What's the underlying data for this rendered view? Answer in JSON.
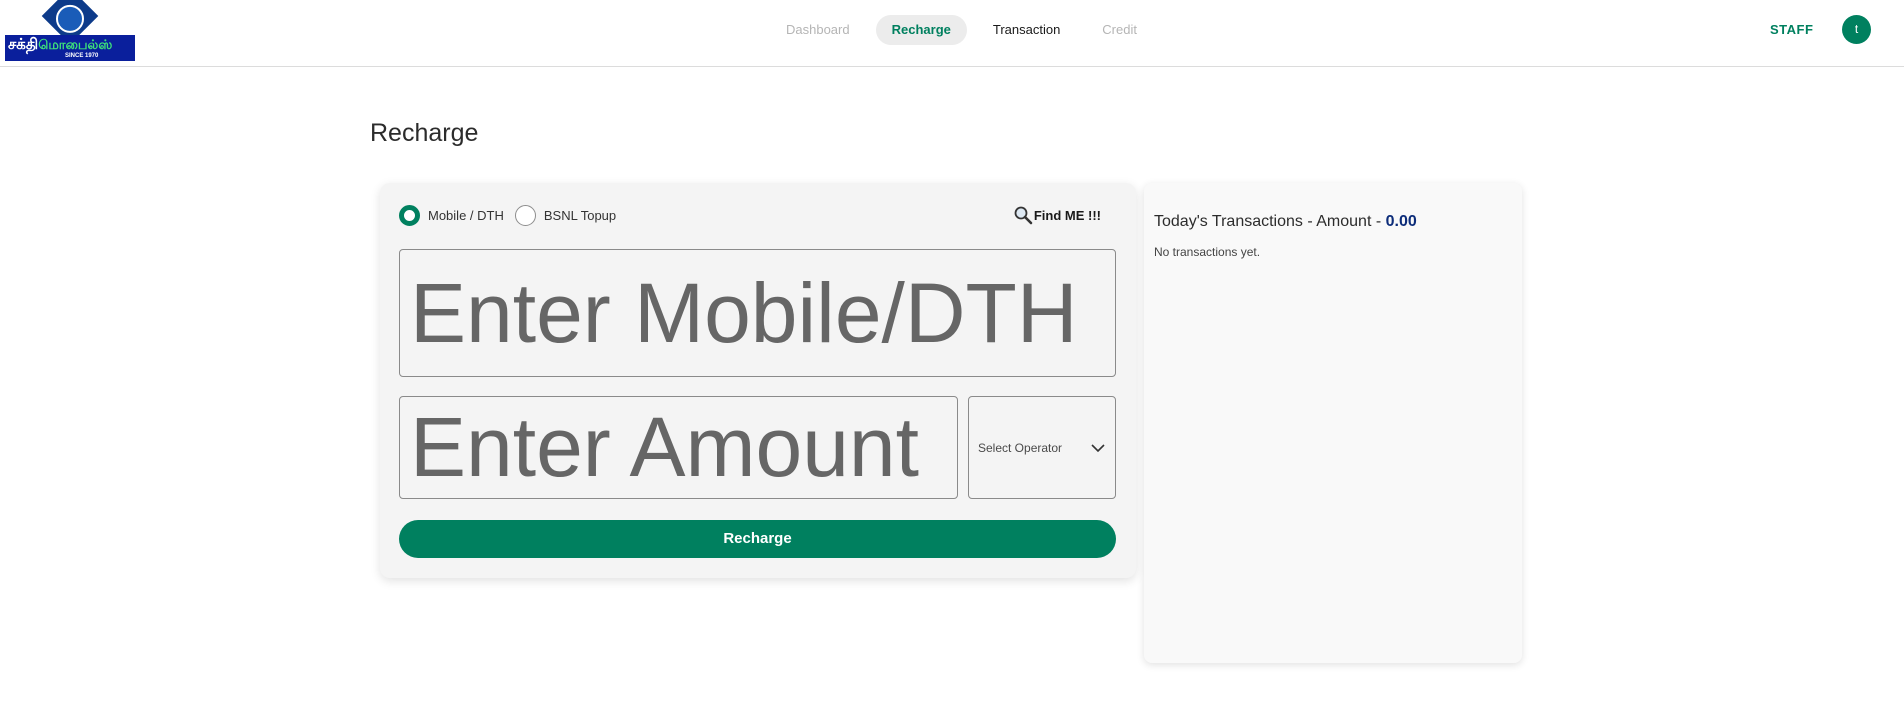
{
  "logo": {
    "text_main": "சக்தி",
    "text_secondary": "மொபைல்ஸ்",
    "tagline": "SINCE 1970"
  },
  "nav": {
    "items": [
      {
        "label": "Dashboard",
        "state": "muted"
      },
      {
        "label": "Recharge",
        "state": "active"
      },
      {
        "label": "Transaction",
        "state": "normal"
      },
      {
        "label": "Credit",
        "state": "muted"
      }
    ]
  },
  "user": {
    "role": "STAFF",
    "avatar_initial": "t"
  },
  "page": {
    "title": "Recharge"
  },
  "recharge_form": {
    "types": [
      {
        "label": "Mobile / DTH",
        "selected": true
      },
      {
        "label": "BSNL Topup",
        "selected": false
      }
    ],
    "find_me_label": "Find ME !!!",
    "number_placeholder": "Enter Mobile/DTH",
    "amount_placeholder": "Enter Amount",
    "operator_placeholder": "Select Operator",
    "submit_label": "Recharge"
  },
  "transactions": {
    "title_prefix": "Today's Transactions - Amount - ",
    "amount": "0.00",
    "empty_message": "No transactions yet."
  },
  "colors": {
    "accent": "#00805f",
    "amount_highlight": "#0d2d7a",
    "logo_banner": "#0a1f9c"
  }
}
